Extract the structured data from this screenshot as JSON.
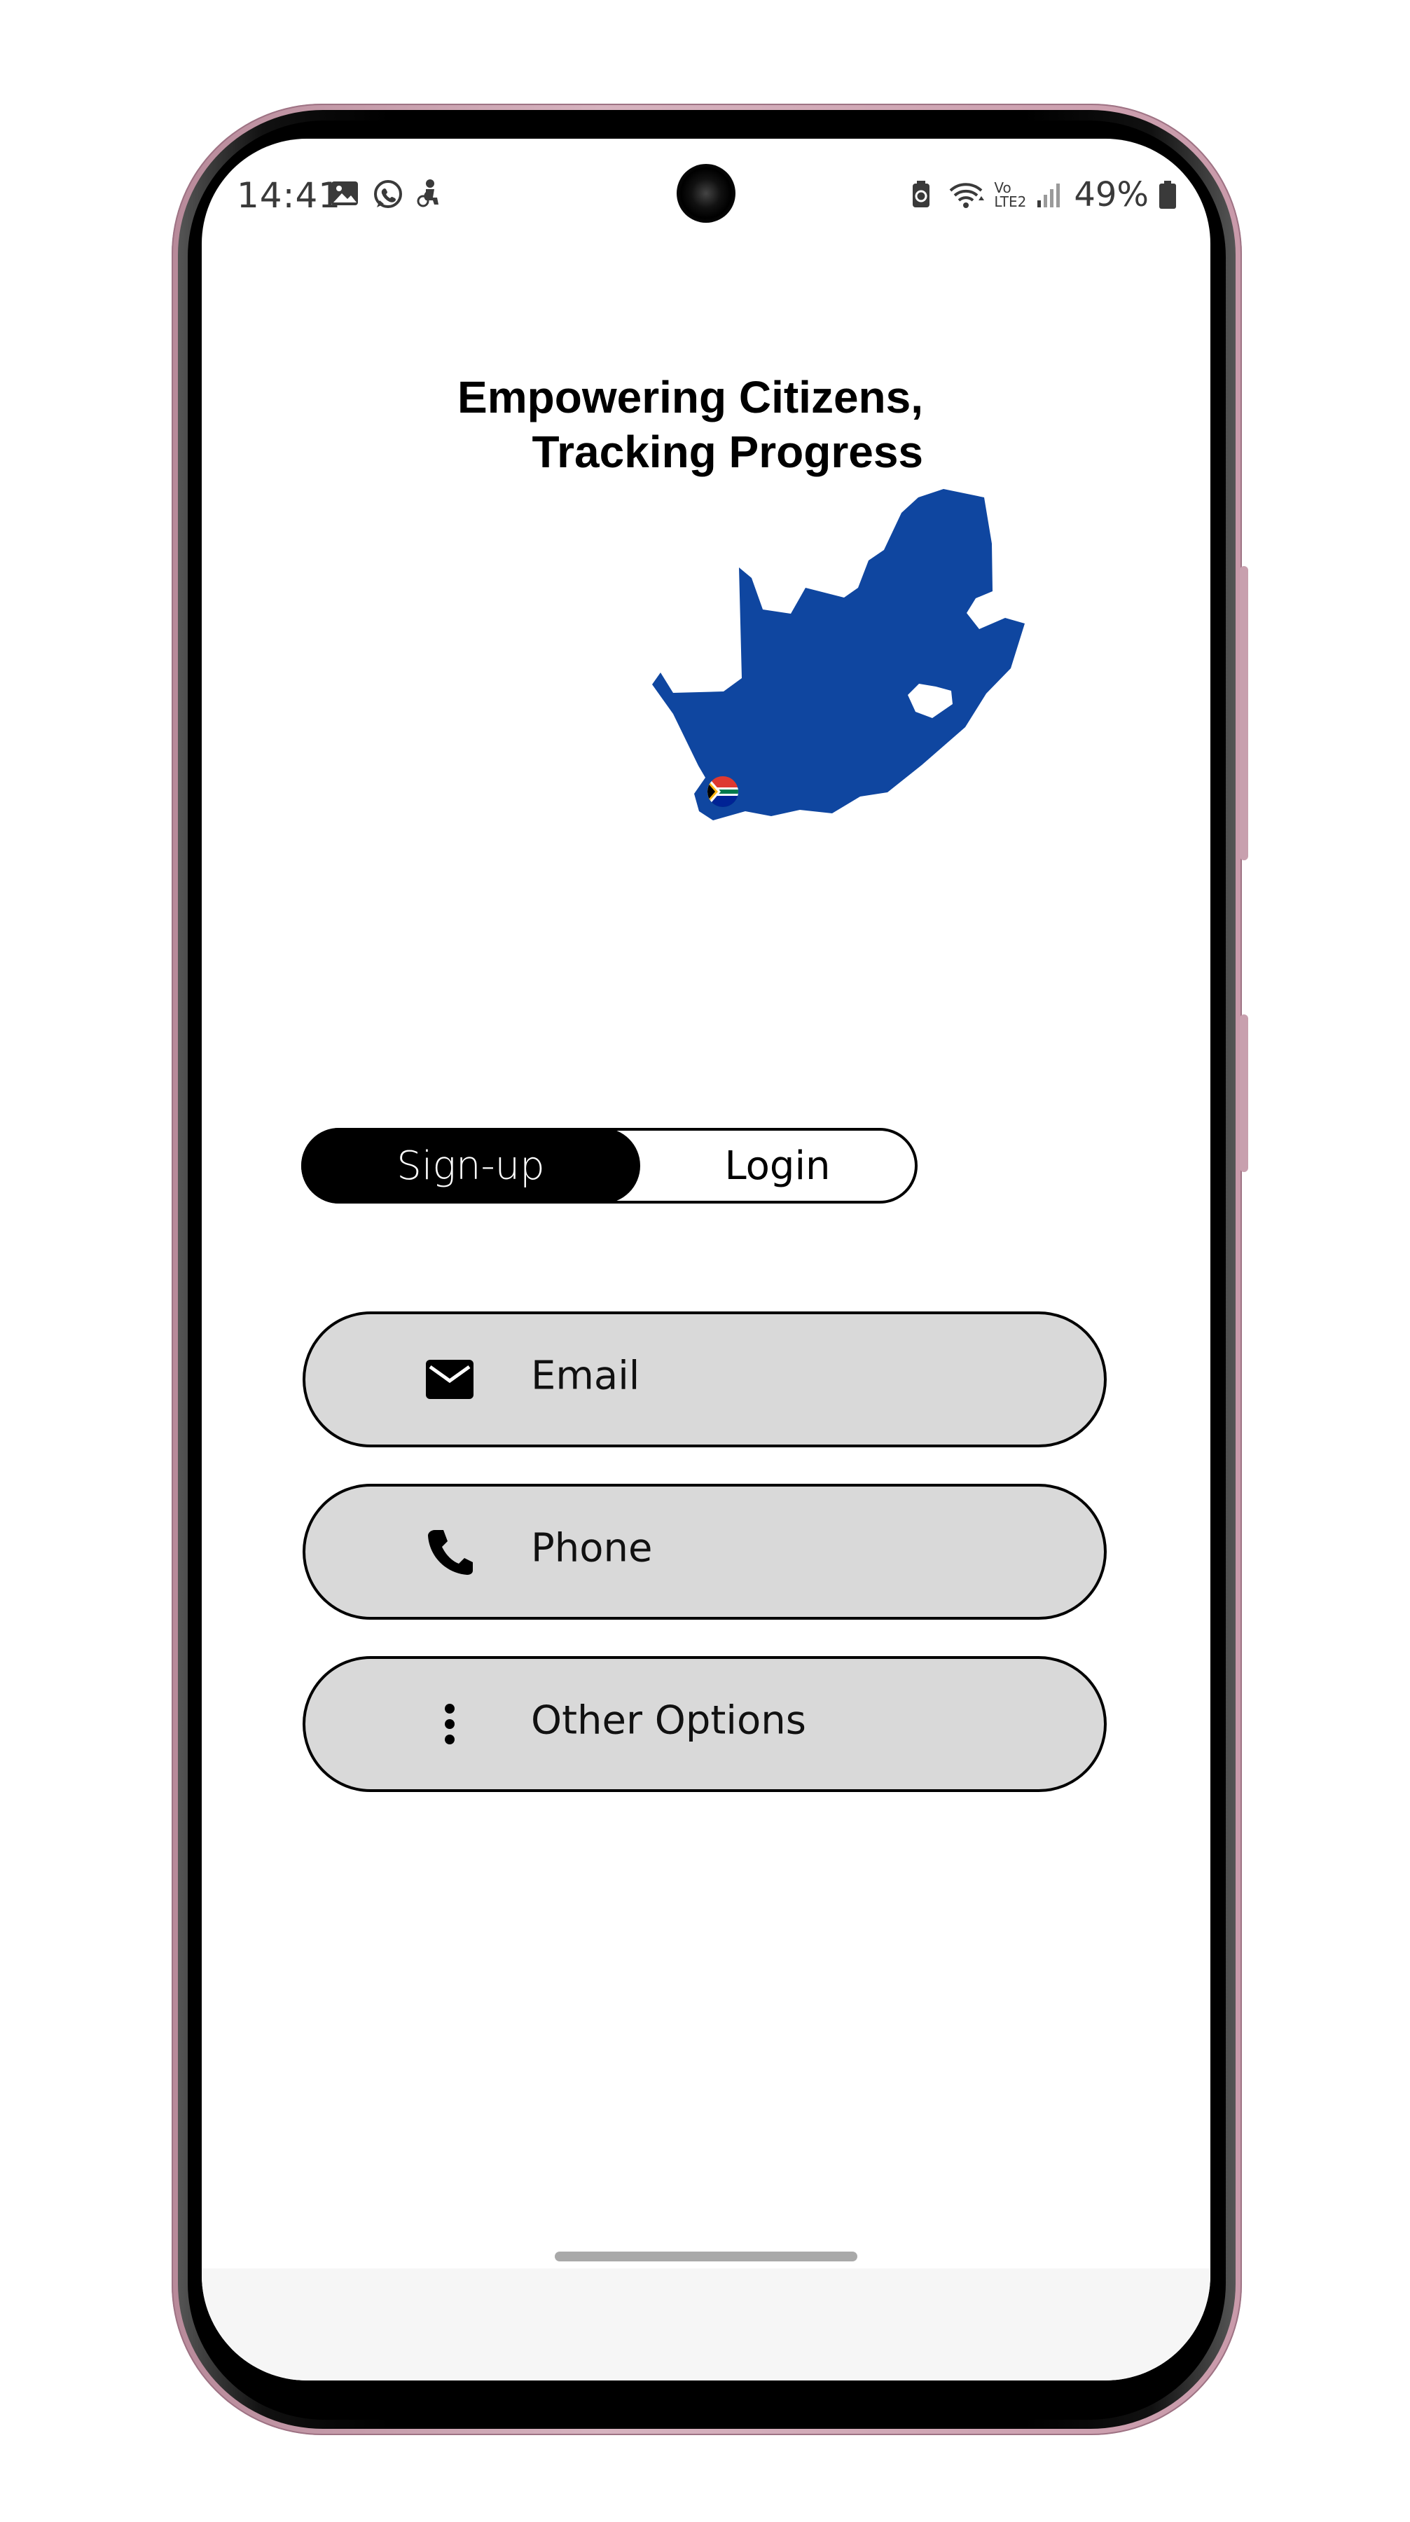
{
  "status_bar": {
    "time": "14:41",
    "battery_percent": "49%",
    "network_label_top": "Vo",
    "network_label_bottom": "LTE2",
    "left_icons": [
      "gallery-icon",
      "whatsapp-icon",
      "accessibility-person-icon"
    ],
    "right_icons": [
      "battery-saver-icon",
      "wifi-icon",
      "signal-icon",
      "battery-icon"
    ]
  },
  "hero": {
    "headline_line1": "Empowering Citizens,",
    "headline_line2": "Tracking Progress",
    "map_color": "#0F46A0",
    "map_icon": "south-africa-map-icon",
    "flag_icon": "south-africa-flag-icon"
  },
  "auth_toggle": {
    "active_label": "Sign-up",
    "inactive_label": "Login"
  },
  "options": [
    {
      "label": "Email",
      "icon": "mail-icon"
    },
    {
      "label": "Phone",
      "icon": "phone-icon"
    },
    {
      "label": "Other Options",
      "icon": "more-vertical-icon"
    }
  ],
  "colors": {
    "button_fill": "#D9D9D9",
    "toggle_active": "#000000",
    "text": "#000000"
  }
}
